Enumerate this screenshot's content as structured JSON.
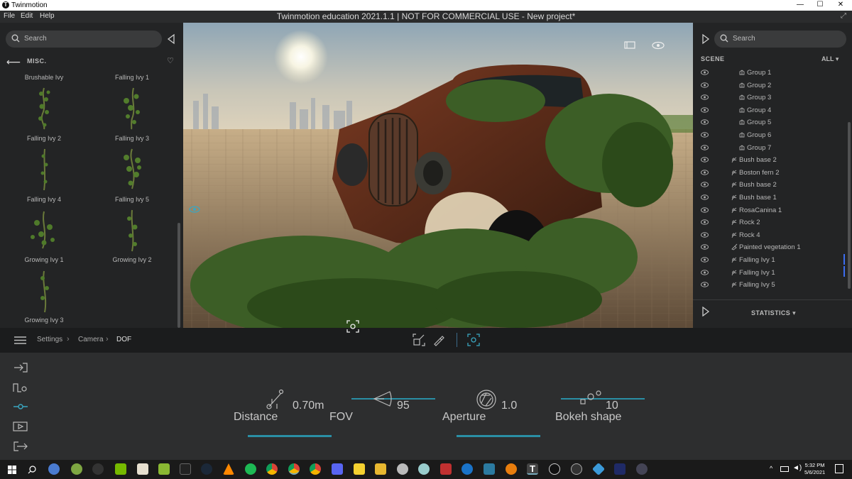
{
  "titlebar": {
    "app_name": "Twinmotion",
    "logo": "T",
    "minimize": "—",
    "maximize": "☐",
    "close": "✕"
  },
  "menubar": {
    "menus": [
      "File",
      "Edit",
      "Help"
    ],
    "window_title": "Twinmotion education 2021.1.1 | NOT FOR COMMERCIAL USE - New project*",
    "expand_icon": "⤢"
  },
  "library": {
    "search_placeholder": "Search",
    "category": "MISC.",
    "back_icon": "arrow-left-icon",
    "items": [
      {
        "label": "Brushable Ivy"
      },
      {
        "label": "Falling Ivy 1"
      },
      {
        "label": "Falling Ivy 2"
      },
      {
        "label": "Falling Ivy 3"
      },
      {
        "label": "Falling Ivy 4"
      },
      {
        "label": "Falling Ivy 5"
      },
      {
        "label": "Growing Ivy 1"
      },
      {
        "label": "Growing Ivy 2"
      },
      {
        "label": "Growing Ivy 3"
      }
    ]
  },
  "scene": {
    "search_placeholder": "Search",
    "title": "SCENE",
    "filter": "ALL",
    "items": [
      {
        "label": "Group 1",
        "icon": "group-icon",
        "indent": 2
      },
      {
        "label": "Group 2",
        "icon": "group-icon",
        "indent": 2
      },
      {
        "label": "Group 3",
        "icon": "group-icon",
        "indent": 2
      },
      {
        "label": "Group 4",
        "icon": "group-icon",
        "indent": 2
      },
      {
        "label": "Group 5",
        "icon": "group-icon",
        "indent": 2
      },
      {
        "label": "Group 6",
        "icon": "group-icon",
        "indent": 2
      },
      {
        "label": "Group 7",
        "icon": "group-icon",
        "indent": 2
      },
      {
        "label": "Bush base 2",
        "icon": "vegetation-icon",
        "indent": 1
      },
      {
        "label": "Boston fern 2",
        "icon": "vegetation-icon",
        "indent": 1
      },
      {
        "label": "Bush base 2",
        "icon": "vegetation-icon",
        "indent": 1
      },
      {
        "label": "Bush base 1",
        "icon": "vegetation-icon",
        "indent": 1
      },
      {
        "label": "RosaCanina 1",
        "icon": "vegetation-icon",
        "indent": 1
      },
      {
        "label": "Rock 2",
        "icon": "vegetation-icon",
        "indent": 1
      },
      {
        "label": "Rock 4",
        "icon": "vegetation-icon",
        "indent": 1
      },
      {
        "label": "Painted vegetation 1",
        "icon": "paint-brush-icon",
        "indent": 1
      },
      {
        "label": "Falling Ivy 1",
        "icon": "vegetation-icon",
        "indent": 1,
        "selected": true
      },
      {
        "label": "Falling Ivy 1",
        "icon": "vegetation-icon",
        "indent": 1,
        "selected": true
      },
      {
        "label": "Falling Ivy 5",
        "icon": "vegetation-icon",
        "indent": 1
      }
    ],
    "statistics": "STATISTICS"
  },
  "breadcrumb": {
    "items": [
      "Settings",
      "Camera",
      "DOF"
    ]
  },
  "dof": {
    "distance": {
      "label": "Distance",
      "value": "0.70m"
    },
    "fov": {
      "label": "FOV",
      "value": "95"
    },
    "aperture": {
      "label": "Aperture",
      "value": "1.0"
    },
    "bokeh": {
      "label": "Bokeh shape",
      "value": "10"
    }
  },
  "taskbar": {
    "time": "5:32 PM",
    "date": "5/6/2021",
    "accent": "#2a9cb4"
  }
}
